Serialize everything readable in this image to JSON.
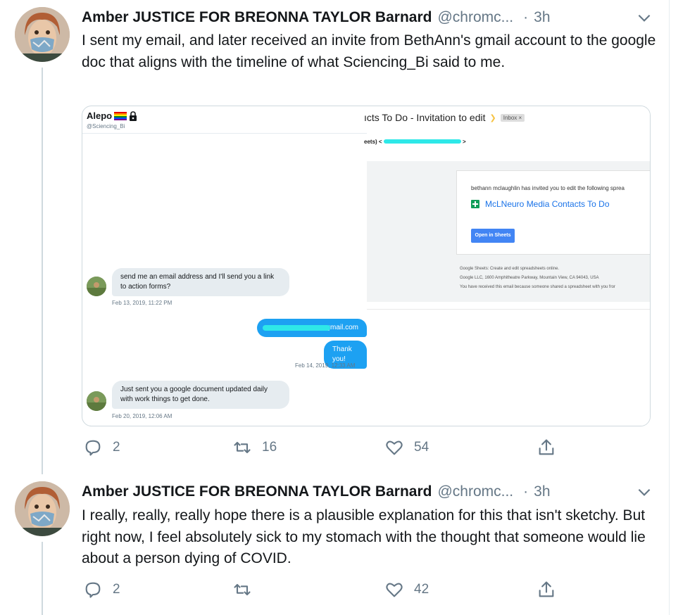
{
  "tweets": [
    {
      "author_name": "Amber JUSTICE FOR BREONNA TAYLOR Barnard",
      "handle": "@chromc...",
      "separator": "·",
      "time": "3h",
      "text": "I sent my email, and later received an invite from BethAnn's gmail account to the google doc that aligns with the timeline of what Sciencing_Bi said to me.",
      "replies": "2",
      "retweets": "16",
      "likes": "54"
    },
    {
      "author_name": "Amber JUSTICE FOR BREONNA TAYLOR Barnard",
      "handle": "@chromc...",
      "separator": "·",
      "time": "3h",
      "text": "I really, really, really hope there is a plausible explanation for this that isn't sketchy. But right now, I feel absolutely sick to my stomach with the thought that someone would lie about a person dying of COVID.",
      "replies": "2",
      "retweets": "",
      "likes": "42"
    }
  ],
  "media": {
    "dm": {
      "name": "Alepo",
      "handle": "@Sciencing_Bi",
      "msg1": "send me an email address and I'll send you a link to action forms?",
      "ts1": "Feb 13, 2019, 11:22 PM",
      "email_suffix": "gmail.com",
      "reply": "Thank you!",
      "ts2": "Feb 14, 2019, 12:33 AM",
      "msg2": "Just sent you a google document updated daily with work things to get done.",
      "ts3": "Feb 20, 2019, 12:06 AM"
    },
    "mail": {
      "subject": "ıcts To Do - Invitation to edit",
      "badge": "Inbox ×",
      "from": "eets) <",
      "from_end": ">",
      "invite_line": "bethann mclaughlin has invited you to edit the following sprea",
      "doc_title": "McLNeuro Media Contacts To Do",
      "button": "Open in Sheets",
      "footer1": "Google Sheets: Create and edit spreadsheets online.",
      "footer2": "Google LLC, 1600 Amphitheatre Parkway, Mountain View, CA 94043, USA",
      "footer3": "You have received this email because someone shared a spreadsheet with you fror"
    }
  },
  "colors": {
    "text_primary": "#14171a",
    "text_secondary": "#657786",
    "twitter_blue": "#1da1f2",
    "gmail_button": "#4285f4",
    "sheets_green": "#0f9d58"
  },
  "icons": [
    "reply-icon",
    "retweet-icon",
    "like-icon",
    "share-icon",
    "caret-down-icon",
    "rainbow-flag-icon",
    "lock-icon",
    "sheets-icon"
  ]
}
